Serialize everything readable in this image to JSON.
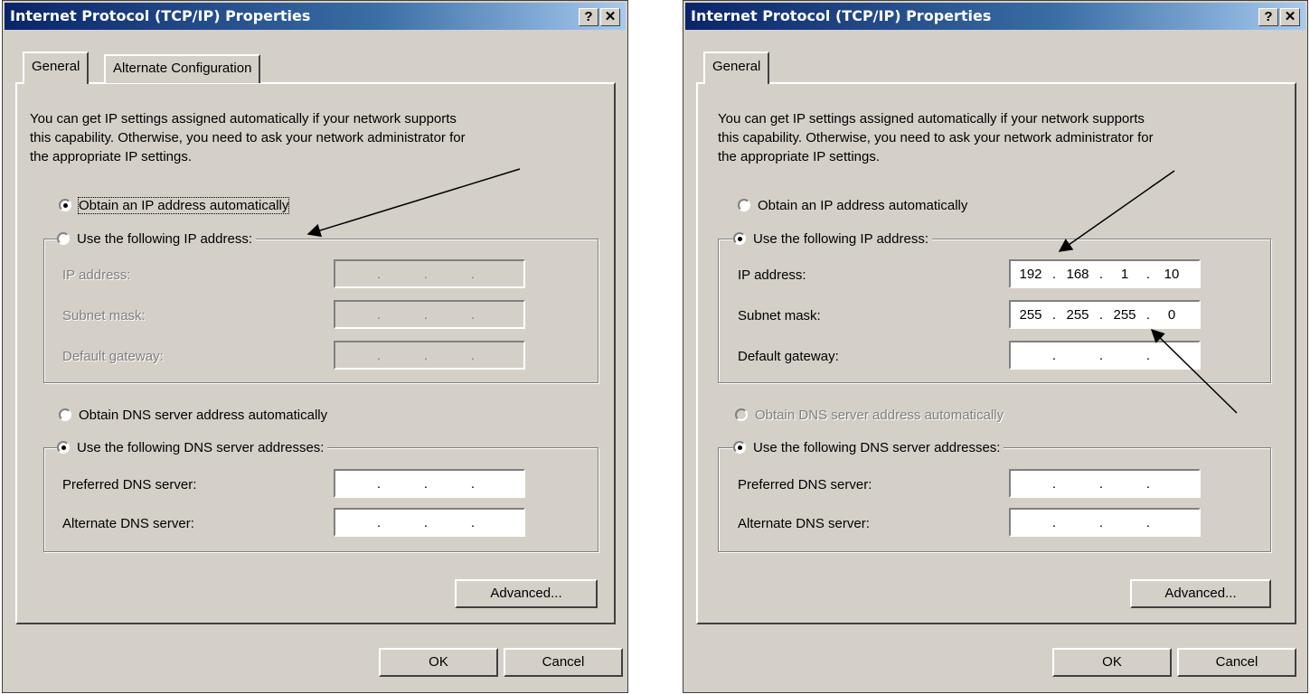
{
  "left": {
    "title": "Internet Protocol (TCP/IP) Properties",
    "tabs": [
      "General",
      "Alternate Configuration"
    ],
    "description": [
      "You can get IP settings assigned automatically if your network supports",
      "this capability. Otherwise, you need to ask your network administrator for",
      "the appropriate IP settings."
    ],
    "obtain_ip_auto": "Obtain an IP address automatically",
    "use_following_ip": "Use the following IP address:",
    "ip_label": "IP address:",
    "subnet_label": "Subnet mask:",
    "gateway_label": "Default gateway:",
    "obtain_dns_auto": "Obtain DNS server address automatically",
    "use_following_dns": "Use the following DNS server addresses:",
    "preferred_dns_label": "Preferred DNS server:",
    "alternate_dns_label": "Alternate DNS server:",
    "advanced_button": "Advanced...",
    "ok_button": "OK",
    "cancel_button": "Cancel"
  },
  "right": {
    "title": "Internet Protocol (TCP/IP) Properties",
    "tabs": [
      "General"
    ],
    "description": [
      "You can get IP settings assigned automatically if your network supports",
      "this capability. Otherwise, you need to ask your network administrator for",
      "the appropriate IP settings."
    ],
    "obtain_ip_auto": "Obtain an IP address automatically",
    "use_following_ip": "Use the following IP address:",
    "ip_label": "IP address:",
    "ip_value": [
      "192",
      "168",
      "1",
      "10"
    ],
    "subnet_label": "Subnet mask:",
    "subnet_value": [
      "255",
      "255",
      "255",
      "0"
    ],
    "gateway_label": "Default gateway:",
    "obtain_dns_auto": "Obtain DNS server address automatically",
    "use_following_dns": "Use the following DNS server addresses:",
    "preferred_dns_label": "Preferred DNS server:",
    "alternate_dns_label": "Alternate DNS server:",
    "advanced_button": "Advanced...",
    "ok_button": "OK",
    "cancel_button": "Cancel"
  },
  "icons": {
    "help": "question-mark-icon",
    "close": "close-icon"
  },
  "colors": {
    "titlebar_start": "#0a246a",
    "titlebar_end": "#a6caf0",
    "dialog_bg": "#d4d0c8"
  }
}
